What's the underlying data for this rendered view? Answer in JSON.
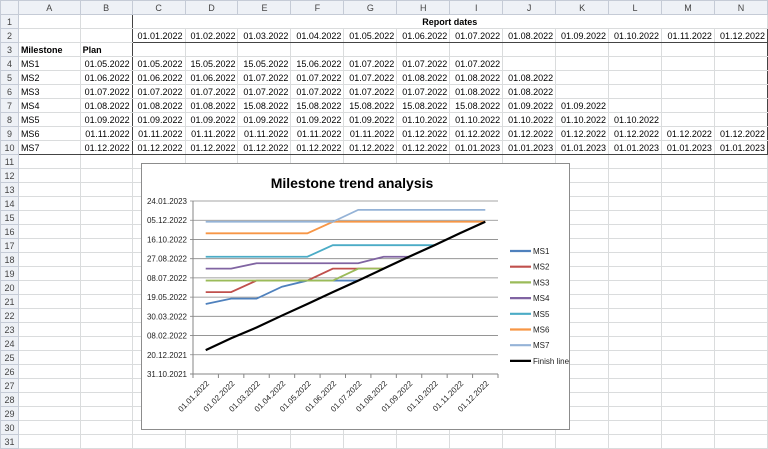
{
  "sheet": {
    "columns": [
      "A",
      "B",
      "C",
      "D",
      "E",
      "F",
      "G",
      "H",
      "I",
      "J",
      "K",
      "L",
      "M",
      "N"
    ],
    "row_numbers": [
      "1",
      "2",
      "3",
      "4",
      "5",
      "6",
      "7",
      "8",
      "9",
      "10",
      "11",
      "12",
      "13",
      "14",
      "15",
      "16",
      "17",
      "18",
      "19",
      "20",
      "21",
      "22",
      "23",
      "24",
      "25",
      "26",
      "27",
      "28",
      "29",
      "30",
      "31"
    ],
    "report_dates_label": "Report dates",
    "report_dates": [
      "01.01.2022",
      "01.02.2022",
      "01.03.2022",
      "01.04.2022",
      "01.05.2022",
      "01.06.2022",
      "01.07.2022",
      "01.08.2022",
      "01.09.2022",
      "01.10.2022",
      "01.11.2022",
      "01.12.2022"
    ],
    "milestone_header": "Milestone",
    "plan_header": "Plan",
    "rows": [
      {
        "name": "MS1",
        "plan": "01.05.2022",
        "values": [
          "01.05.2022",
          "15.05.2022",
          "15.05.2022",
          "15.06.2022",
          "01.07.2022",
          "01.07.2022",
          "01.07.2022",
          "",
          "",
          "",
          "",
          ""
        ]
      },
      {
        "name": "MS2",
        "plan": "01.06.2022",
        "values": [
          "01.06.2022",
          "01.06.2022",
          "01.07.2022",
          "01.07.2022",
          "01.07.2022",
          "01.08.2022",
          "01.08.2022",
          "01.08.2022",
          "",
          "",
          "",
          ""
        ]
      },
      {
        "name": "MS3",
        "plan": "01.07.2022",
        "values": [
          "01.07.2022",
          "01.07.2022",
          "01.07.2022",
          "01.07.2022",
          "01.07.2022",
          "01.07.2022",
          "01.08.2022",
          "01.08.2022",
          "",
          "",
          "",
          ""
        ]
      },
      {
        "name": "MS4",
        "plan": "01.08.2022",
        "values": [
          "01.08.2022",
          "01.08.2022",
          "15.08.2022",
          "15.08.2022",
          "15.08.2022",
          "15.08.2022",
          "15.08.2022",
          "01.09.2022",
          "01.09.2022",
          "",
          "",
          ""
        ]
      },
      {
        "name": "MS5",
        "plan": "01.09.2022",
        "values": [
          "01.09.2022",
          "01.09.2022",
          "01.09.2022",
          "01.09.2022",
          "01.09.2022",
          "01.10.2022",
          "01.10.2022",
          "01.10.2022",
          "01.10.2022",
          "01.10.2022",
          "",
          ""
        ]
      },
      {
        "name": "MS6",
        "plan": "01.11.2022",
        "values": [
          "01.11.2022",
          "01.11.2022",
          "01.11.2022",
          "01.11.2022",
          "01.11.2022",
          "01.12.2022",
          "01.12.2022",
          "01.12.2022",
          "01.12.2022",
          "01.12.2022",
          "01.12.2022",
          "01.12.2022"
        ]
      },
      {
        "name": "MS7",
        "plan": "01.12.2022",
        "values": [
          "01.12.2022",
          "01.12.2022",
          "01.12.2022",
          "01.12.2022",
          "01.12.2022",
          "01.12.2022",
          "01.01.2023",
          "01.01.2023",
          "01.01.2023",
          "01.01.2023",
          "01.01.2023",
          "01.01.2023"
        ]
      }
    ]
  },
  "chart_data": {
    "type": "line",
    "title": "Milestone trend analysis",
    "x": [
      "01.01.2022",
      "01.02.2022",
      "01.03.2022",
      "01.04.2022",
      "01.05.2022",
      "01.06.2022",
      "01.07.2022",
      "01.08.2022",
      "01.09.2022",
      "01.10.2022",
      "01.11.2022",
      "01.12.2022"
    ],
    "y_ticks": [
      "31.10.2021",
      "20.12.2021",
      "08.02.2022",
      "30.03.2022",
      "19.05.2022",
      "08.07.2022",
      "27.08.2022",
      "16.10.2022",
      "05.12.2022",
      "24.01.2023"
    ],
    "ylim": [
      "31.10.2021",
      "24.01.2023"
    ],
    "grid": true,
    "legend": "right",
    "series": [
      {
        "name": "MS1",
        "color": "#4f81bd",
        "values": [
          "01.05.2022",
          "15.05.2022",
          "15.05.2022",
          "15.06.2022",
          "01.07.2022",
          "01.07.2022",
          "01.07.2022",
          null,
          null,
          null,
          null,
          null
        ]
      },
      {
        "name": "MS2",
        "color": "#c0504d",
        "values": [
          "01.06.2022",
          "01.06.2022",
          "01.07.2022",
          "01.07.2022",
          "01.07.2022",
          "01.08.2022",
          "01.08.2022",
          "01.08.2022",
          null,
          null,
          null,
          null
        ]
      },
      {
        "name": "MS3",
        "color": "#9bbb59",
        "values": [
          "01.07.2022",
          "01.07.2022",
          "01.07.2022",
          "01.07.2022",
          "01.07.2022",
          "01.07.2022",
          "01.08.2022",
          "01.08.2022",
          null,
          null,
          null,
          null
        ]
      },
      {
        "name": "MS4",
        "color": "#8064a2",
        "values": [
          "01.08.2022",
          "01.08.2022",
          "15.08.2022",
          "15.08.2022",
          "15.08.2022",
          "15.08.2022",
          "15.08.2022",
          "01.09.2022",
          "01.09.2022",
          null,
          null,
          null
        ]
      },
      {
        "name": "MS5",
        "color": "#4bacc6",
        "values": [
          "01.09.2022",
          "01.09.2022",
          "01.09.2022",
          "01.09.2022",
          "01.09.2022",
          "01.10.2022",
          "01.10.2022",
          "01.10.2022",
          "01.10.2022",
          "01.10.2022",
          null,
          null
        ]
      },
      {
        "name": "MS6",
        "color": "#f79646",
        "values": [
          "01.11.2022",
          "01.11.2022",
          "01.11.2022",
          "01.11.2022",
          "01.11.2022",
          "01.12.2022",
          "01.12.2022",
          "01.12.2022",
          "01.12.2022",
          "01.12.2022",
          "01.12.2022",
          "01.12.2022"
        ]
      },
      {
        "name": "MS7",
        "color": "#95b3d7",
        "values": [
          "01.12.2022",
          "01.12.2022",
          "01.12.2022",
          "01.12.2022",
          "01.12.2022",
          "01.12.2022",
          "01.01.2023",
          "01.01.2023",
          "01.01.2023",
          "01.01.2023",
          "01.01.2023",
          "01.01.2023"
        ]
      },
      {
        "name": "Finish line",
        "color": "#000000",
        "values": [
          "01.01.2022",
          "01.02.2022",
          "01.03.2022",
          "01.04.2022",
          "01.05.2022",
          "01.06.2022",
          "01.07.2022",
          "01.08.2022",
          "01.09.2022",
          "01.10.2022",
          "01.11.2022",
          "01.12.2022"
        ]
      }
    ]
  }
}
